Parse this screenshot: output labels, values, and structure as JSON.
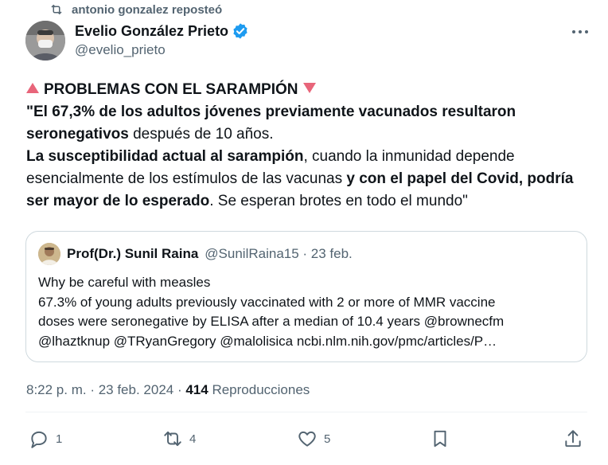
{
  "repost": {
    "text": "antonio gonzalez reposteó",
    "icon": "repost-icon"
  },
  "author": {
    "name": "Evelio González Prieto",
    "handle": "@evelio_prieto",
    "verified": true
  },
  "tweet": {
    "heading": "PROBLEMAS CON EL SARAMPIÓN",
    "line1_bold": "\"El 67,3% de los adultos jóvenes previamente vacunados  resultaron seronegativos",
    "line1_rest": " después de 10 años.",
    "line2_bold": "La susceptibilidad actual al sarampión",
    "line2_rest": ", cuando la inmunidad depende esencialmente de los estímulos de las vacunas ",
    "line3_bold": "y con el papel del Covid, podría ser mayor de lo esperado",
    "line3_rest": ". Se esperan brotes en todo el mundo\""
  },
  "quote": {
    "author": "Prof(Dr.) Sunil Raina",
    "meta": "@SunilRaina15 · 23 feb.",
    "lines": [
      "Why be careful with measles",
      "67.3% of young adults previously vaccinated with 2 or more of MMR vaccine",
      "doses were seronegative by ELISA after a median of 10.4 years @brownecfm",
      "@lhaztknup @TRyanGregory @malolisica  ncbi.nlm.nih.gov/pmc/articles/P…"
    ]
  },
  "meta": {
    "timestamp": "8:22 p. m. · 23 feb. 2024 · ",
    "views_count": "414",
    "views_label": " Reproducciones"
  },
  "actions": {
    "replies": "1",
    "reposts": "4",
    "likes": "5"
  },
  "colors": {
    "accent": "#1d9bf0",
    "muted": "#536471",
    "triangle": "#e8657a"
  }
}
